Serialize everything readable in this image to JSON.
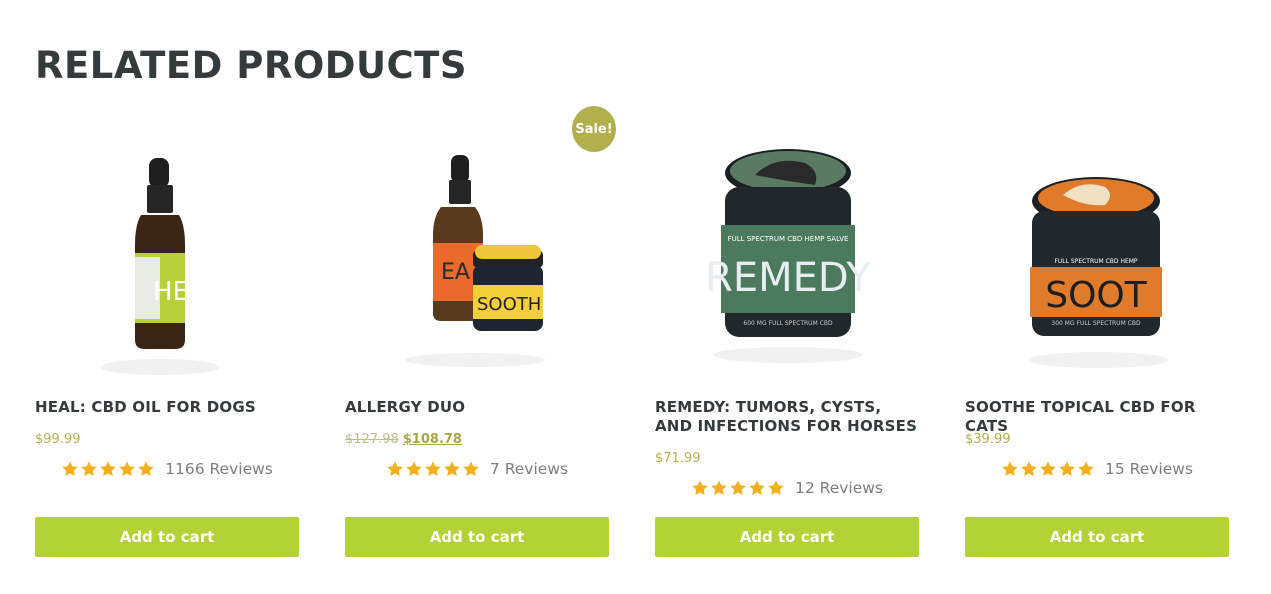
{
  "section": {
    "title": "RELATED PRODUCTS"
  },
  "products": [
    {
      "title": "HEAL: CBD OIL FOR DOGS",
      "price": "$99.99",
      "rating": 5,
      "reviews": "1166 Reviews",
      "button": "Add to cart",
      "image_label": "HEA"
    },
    {
      "title": "ALLERGY DUO",
      "sale_badge": "Sale!",
      "old_price": "$127.98",
      "price": "$108.78",
      "rating": 5,
      "reviews": "7 Reviews",
      "button": "Add to cart",
      "image_label": "EA",
      "image_label_2": "SOOTH"
    },
    {
      "title": "REMEDY: TUMORS, CYSTS, AND INFECTIONS FOR HORSES",
      "price": "$71.99",
      "rating": 5,
      "reviews": "12 Reviews",
      "button": "Add to cart",
      "image_label": "REMEDY",
      "image_sublabel": "FULL SPECTRUM CBD HEMP SALVE",
      "image_footer": "600 MG FULL SPECTRUM CBD"
    },
    {
      "title": "SOOTHE TOPICAL CBD FOR CATS",
      "price": "$39.99",
      "rating": 5,
      "reviews": "15 Reviews",
      "button": "Add to cart",
      "image_label": "SOOT",
      "image_sublabel": "FULL SPECTRUM CBD HEMP",
      "image_footer": "300 MG FULL SPECTRUM CBD"
    }
  ],
  "colors": {
    "accent_button": "#b2d235",
    "price": "#b1b04c",
    "sale_badge": "#b1b04c",
    "star": "#f3b01c",
    "heading": "#353b3c"
  }
}
